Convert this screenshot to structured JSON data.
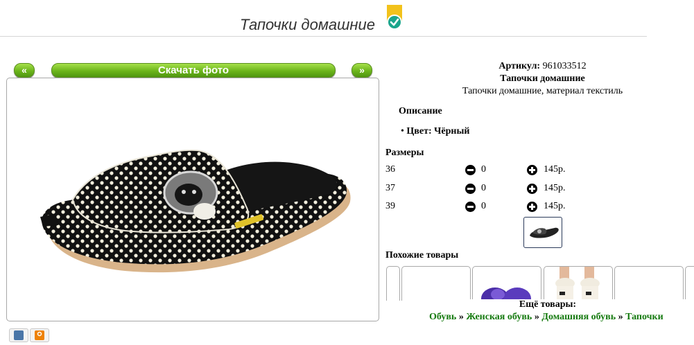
{
  "header": {
    "title": "Тапочки домашние"
  },
  "photo_nav": {
    "prev_label": "«",
    "download_label": "Скачать фото",
    "next_label": "»"
  },
  "product": {
    "sku_label": "Артикул:",
    "sku_value": "961033512",
    "name": "Тапочки домашние",
    "description": "Тапочки домашние, материал текстиль"
  },
  "description_section": {
    "heading": "Описание",
    "color_label": "Цвет:",
    "color_value": "Чёрный"
  },
  "sizes": {
    "heading": "Размеры",
    "rows": [
      {
        "size": "36",
        "qty": "0",
        "price": "145р."
      },
      {
        "size": "37",
        "qty": "0",
        "price": "145р."
      },
      {
        "size": "39",
        "qty": "0",
        "price": "145р."
      }
    ]
  },
  "similar": {
    "heading": "Похожие товары"
  },
  "more": {
    "heading": "Ещё товары:",
    "breadcrumbs": [
      "Обувь",
      "Женская обувь",
      "Домашняя обувь",
      "Тапочки"
    ],
    "separator": "»"
  },
  "share": {
    "vk_label": "В",
    "ok_label": "О"
  },
  "colors": {
    "accent_green": "#6cb51c",
    "link_green": "#157a0f",
    "badge_teal": "#1aa58c",
    "badge_yellow": "#f2c21b"
  },
  "icons": [
    "verified-badge-icon",
    "minus-circle-icon",
    "plus-circle-icon",
    "vk-icon",
    "odnoklassniki-icon"
  ]
}
